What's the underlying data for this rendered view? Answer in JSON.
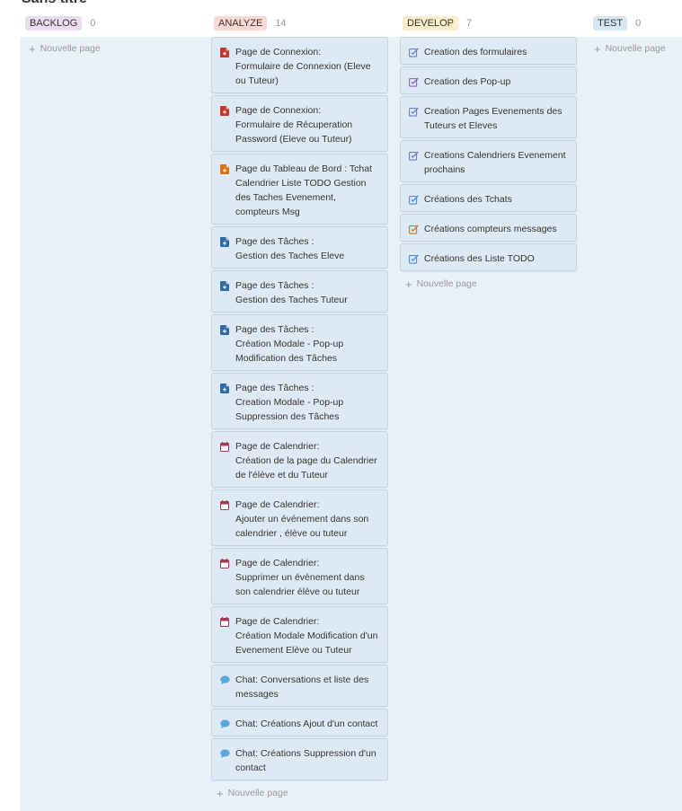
{
  "board": {
    "title": "Sans titre",
    "columns": [
      {
        "key": "backlog",
        "label": "BACKLOG",
        "count": "0",
        "badge_color": "#eadcef",
        "new_page": "Nouvelle page",
        "cards": []
      },
      {
        "key": "analyze",
        "label": "ANALYZE",
        "count": "14",
        "badge_color": "#f9d8d3",
        "new_page": "Nouvelle page",
        "cards": [
          {
            "icon": "page-red-icon",
            "title": "Page de Connexion:\nFormulaire de Connexion (Eleve ou Tuteur)"
          },
          {
            "icon": "page-red-icon",
            "title": "Page de Connexion:\nFormulaire de Récuperation Password (Eleve ou Tuteur)"
          },
          {
            "icon": "page-orange-icon",
            "title": "Page du Tableau de Bord : Tchat Calendrier Liste TODO Gestion des Taches Evenement, compteurs Msg"
          },
          {
            "icon": "page-blue-icon",
            "title": "Page des Tâches :\nGestion des Taches Eleve"
          },
          {
            "icon": "page-blue-icon",
            "title": "Page des Tâches :\nGestion des Taches Tuteur"
          },
          {
            "icon": "page-blue-icon",
            "title": "Page des Tâches :\nCréation Modale  -  Pop-up Modification des Tâches"
          },
          {
            "icon": "page-blue-icon",
            "title": "Page des Tâches :\nCreation Modale  -  Pop-up Suppression des Tâches"
          },
          {
            "icon": "calendar-icon",
            "title": "Page de Calendrier:\nCréation de la page du Calendrier de l'élève et du Tuteur"
          },
          {
            "icon": "calendar-icon",
            "title": "Page de Calendrier:\nAjouter un événement dans son calendrier , élève ou tuteur"
          },
          {
            "icon": "calendar-icon",
            "title": "Page de Calendrier:\nSupprimer un évènement dans son calendrier  élève ou tuteur"
          },
          {
            "icon": "calendar-icon",
            "title": "Page de Calendrier:\nCréation Modale Modification d'un Evenement Elève ou Tuteur"
          },
          {
            "icon": "chat-bubble-icon",
            "title": "Chat: Conversations et liste des messages"
          },
          {
            "icon": "chat-bubble-icon",
            "title": "Chat: Créations  Ajout d'un contact"
          },
          {
            "icon": "chat-bubble-icon",
            "title": "Chat: Créations  Suppression d'un contact"
          }
        ]
      },
      {
        "key": "develop",
        "label": "DEVELOP",
        "count": "7",
        "badge_color": "#fbeecb",
        "new_page": "Nouvelle page",
        "cards": [
          {
            "icon": "edit-checkbox-icon",
            "title": "Creation des  formulaires"
          },
          {
            "icon": "edit-checkbox-icon",
            "title": "Creation des Pop-up"
          },
          {
            "icon": "edit-checkbox-icon",
            "title": "Creation Pages  Evenements des Tuteurs et Eleves"
          },
          {
            "icon": "edit-checkbox-icon",
            "title": "Creations Calendriers Evenement prochains"
          },
          {
            "icon": "edit-checkbox-icon",
            "title": "Créations des Tchats"
          },
          {
            "icon": "edit-checkbox-icon",
            "title": "Créations compteurs messages"
          },
          {
            "icon": "edit-checkbox-icon",
            "title": "Créations des Liste TODO"
          }
        ]
      },
      {
        "key": "test",
        "label": "TEST",
        "count": "0",
        "badge_color": "#d6e6f2",
        "new_page": "Nouvelle page",
        "cards": []
      }
    ]
  },
  "icon_colors": {
    "page-red-icon": "#c0392b",
    "page-orange-icon": "#d9730d",
    "page-blue-icon": "#2e6da4",
    "calendar-icon": "#a33a4e",
    "chat-bubble-icon": "#5aa9dd",
    "edit-checkbox-icon": "#6a7fc0"
  },
  "develop_icon_colors": [
    "#6a7fc0",
    "#8e63c8",
    "#6a7fc0",
    "#6a7fc0",
    "#4a90d9",
    "#d9730d",
    "#4a90d9"
  ]
}
